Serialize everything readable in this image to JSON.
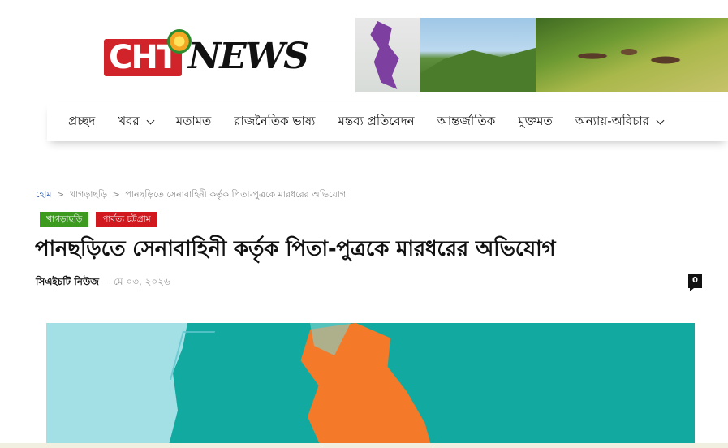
{
  "site": {
    "logo_text": "CHTNEWS"
  },
  "nav": {
    "items": [
      {
        "label": "প্রচ্ছদ",
        "has_dropdown": false
      },
      {
        "label": "খবর",
        "has_dropdown": true
      },
      {
        "label": "মতামত",
        "has_dropdown": false
      },
      {
        "label": "রাজনৈতিক ভাষ্য",
        "has_dropdown": false
      },
      {
        "label": "মন্তব্য প্রতিবেদন",
        "has_dropdown": false
      },
      {
        "label": "আন্তর্জাতিক",
        "has_dropdown": false
      },
      {
        "label": "মুক্তমত",
        "has_dropdown": false
      },
      {
        "label": "অন্যায়-অবিচার",
        "has_dropdown": true
      }
    ]
  },
  "breadcrumb": {
    "home": "হোম",
    "separator": ">",
    "category": "খাগড়াছড়ি",
    "current": "পানছড়িতে সেনাবাহিনী কর্তৃক পিতা-পুত্রকে মারধরের অভিযোগ"
  },
  "article": {
    "categories": [
      {
        "label": "খাগড়াছড়ি",
        "color": "#3c9a1f"
      },
      {
        "label": "পার্বত্য চট্টগ্রাম",
        "color": "#d0181e"
      }
    ],
    "title": "পানছড়িতে সেনাবাহিনী কর্তৃক পিতা-পুত্রকে মারধরের অভিযোগ",
    "author": "সিএইচটি নিউজ",
    "meta_separator": "-",
    "date": "মে ০৩, ২০২৬",
    "comment_count": "0"
  },
  "colors": {
    "brand_red": "#d1232a",
    "link_blue": "#2a5db0",
    "tag_green": "#3c9a1f",
    "tag_red": "#d0181e",
    "image_teal": "#12aaa0",
    "image_orange": "#f47a2a"
  }
}
